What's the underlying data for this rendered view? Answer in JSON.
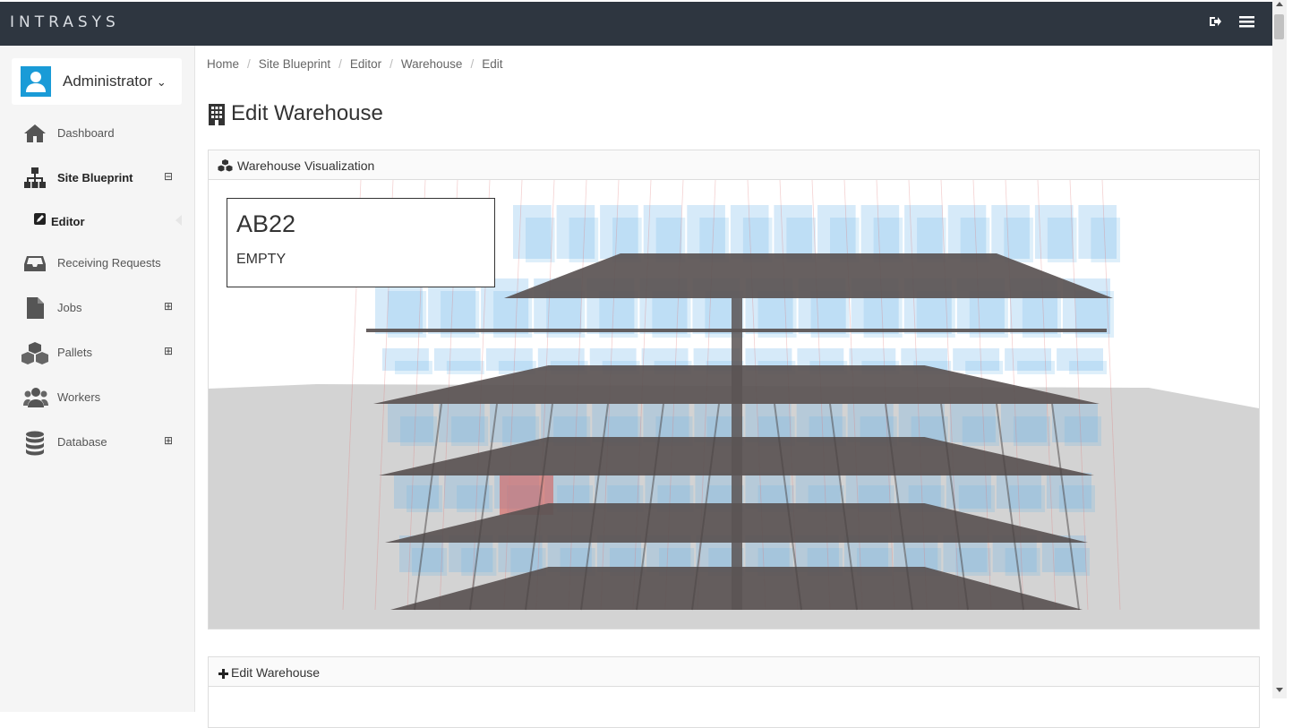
{
  "app": {
    "logo": "INTRASYS"
  },
  "topbar": {
    "logout_icon": "sign-out-icon",
    "menu_icon": "hamburger-menu-icon"
  },
  "user": {
    "name": "Administrator",
    "chevron": "⌄"
  },
  "sidebar": {
    "items": [
      {
        "label": "Dashboard",
        "icon": "home-icon",
        "toggle": ""
      },
      {
        "label": "Site Blueprint",
        "icon": "sitemap-icon",
        "toggle": "⊟",
        "active": true
      },
      {
        "label": "Editor",
        "icon": "edit-icon",
        "toggle": ""
      },
      {
        "label": "Receiving Requests",
        "icon": "inbox-icon",
        "toggle": ""
      },
      {
        "label": "Jobs",
        "icon": "file-icon",
        "toggle": "⊞"
      },
      {
        "label": "Pallets",
        "icon": "cubes-icon",
        "toggle": "⊞"
      },
      {
        "label": "Workers",
        "icon": "users-icon",
        "toggle": ""
      },
      {
        "label": "Database",
        "icon": "database-icon",
        "toggle": "⊞"
      }
    ]
  },
  "breadcrumb": [
    "Home",
    "Site Blueprint",
    "Editor",
    "Warehouse",
    "Edit"
  ],
  "page": {
    "title": "Edit Warehouse"
  },
  "viz_panel": {
    "title": "Warehouse Visualization"
  },
  "location_info": {
    "code": "AB22",
    "status": "EMPTY"
  },
  "edit_panel": {
    "title": "Edit Warehouse"
  },
  "colors": {
    "topbar": "#2e3640",
    "accent": "#1a9bd7",
    "shelf": "#5a5353",
    "box": "#6ab4ea",
    "highlight": "#d9534f"
  }
}
